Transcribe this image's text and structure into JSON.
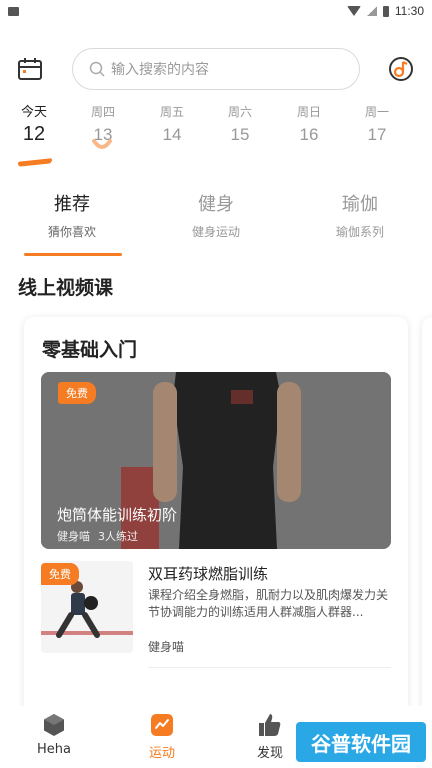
{
  "status_bar": {
    "time": "11:30"
  },
  "header": {
    "search_placeholder": "输入搜索的内容"
  },
  "days": [
    {
      "name": "今天",
      "num": "12"
    },
    {
      "name": "周四",
      "num": "13"
    },
    {
      "name": "周五",
      "num": "14"
    },
    {
      "name": "周六",
      "num": "15"
    },
    {
      "name": "周日",
      "num": "16"
    },
    {
      "name": "周一",
      "num": "17"
    }
  ],
  "tabs": [
    {
      "title": "推荐",
      "sub": "猜你喜欢"
    },
    {
      "title": "健身",
      "sub": "健身运动"
    },
    {
      "title": "瑜伽",
      "sub": "瑜伽系列"
    }
  ],
  "section_title": "线上视频课",
  "card": {
    "title": "零基础入门",
    "feature": {
      "badge": "免费",
      "title": "炮筒体能训练初阶",
      "author": "健身喵",
      "count": "3人练过"
    },
    "course": {
      "badge": "免费",
      "title": "双耳药球燃脂训练",
      "desc": "课程介绍全身燃脂，肌耐力以及肌肉爆发力关节协调能力的训练适用人群减脂人群器...",
      "author": "健身喵"
    }
  },
  "bottom_nav": [
    {
      "label": "Heha"
    },
    {
      "label": "运动"
    },
    {
      "label": "发现"
    }
  ],
  "watermark": "谷普软件园",
  "colors": {
    "accent": "#f57c22"
  }
}
